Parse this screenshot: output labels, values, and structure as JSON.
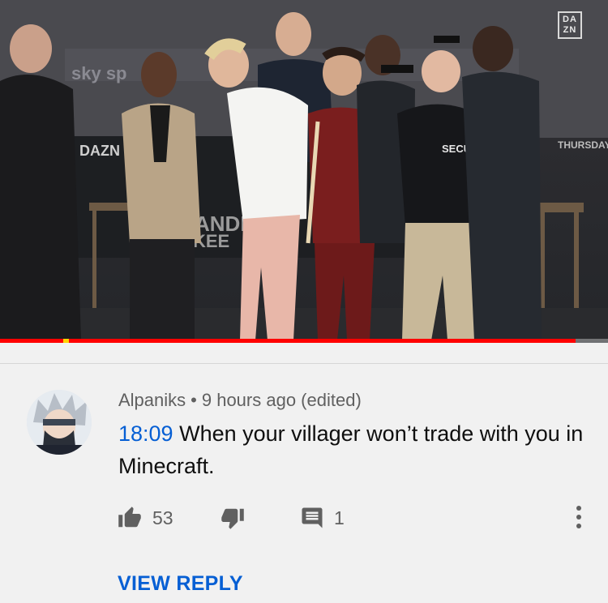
{
  "video": {
    "watermark": "DAZN",
    "progress": 0.947,
    "backdrop_texts": [
      "sky sp",
      "DAZN",
      "ANDR",
      "KEE",
      "THURSDAY",
      "SECURITY"
    ]
  },
  "comment": {
    "author": "Alpaniks",
    "separator": "•",
    "time": "9 hours ago (edited)",
    "timestamp_link": "18:09",
    "text": " When your villager won’t trade with you in Minecraft.",
    "likes": "53",
    "replies": "1",
    "view_reply_label": "VIEW REPLY"
  },
  "icons": {
    "like": "thumb-up-icon",
    "dislike": "thumb-down-icon",
    "reply": "comment-icon",
    "more": "more-vert-icon"
  },
  "colors": {
    "link_blue": "#065fd4",
    "progress_red": "#ff0000",
    "meta_gray": "#606060",
    "background": "#f1f1f1"
  }
}
